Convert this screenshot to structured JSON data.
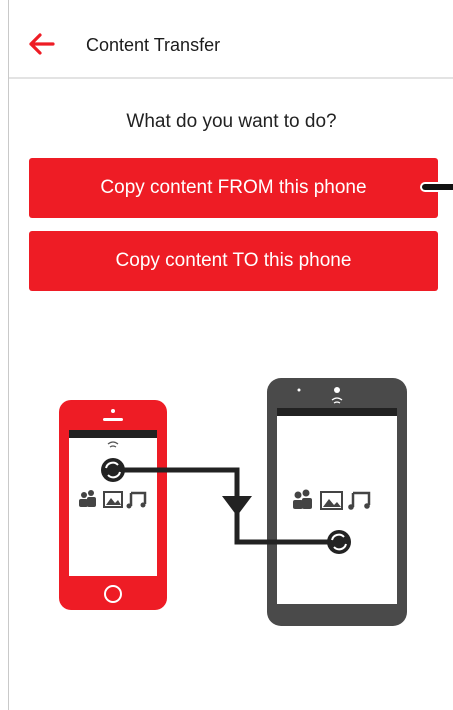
{
  "header": {
    "title": "Content Transfer",
    "back_icon": "arrow-left-icon",
    "accent_color": "#ee1c25"
  },
  "main": {
    "question": "What do you want to do?",
    "copy_from_label": "Copy content FROM this phone",
    "copy_to_label": "Copy content TO this phone"
  },
  "illustration": {
    "source_device": "red-smartphone",
    "target_device": "black-smartphone",
    "icons": [
      "sync-icon",
      "contacts-icon",
      "photos-icon",
      "music-icon"
    ]
  }
}
